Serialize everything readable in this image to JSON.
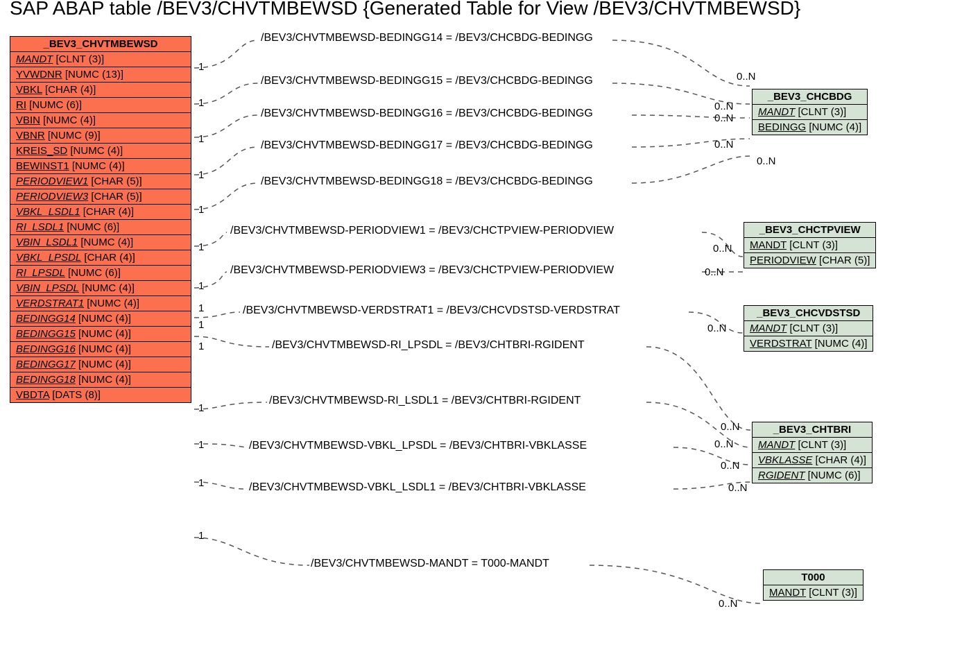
{
  "title": "SAP ABAP table /BEV3/CHVTMBEWSD {Generated Table for View /BEV3/CHVTMBEWSD}",
  "main": {
    "name": "_BEV3_CHVTMBEWSD",
    "rows": [
      {
        "f": "MANDT",
        "t": " [CLNT (3)]",
        "u": 1,
        "i": 1
      },
      {
        "f": "YVWDNR",
        "t": " [NUMC (13)]",
        "u": 1,
        "i": 0
      },
      {
        "f": "VBKL",
        "t": " [CHAR (4)]",
        "u": 1,
        "i": 0
      },
      {
        "f": "RI",
        "t": " [NUMC (6)]",
        "u": 1,
        "i": 0
      },
      {
        "f": "VBIN",
        "t": " [NUMC (4)]",
        "u": 1,
        "i": 0
      },
      {
        "f": "VBNR",
        "t": " [NUMC (9)]",
        "u": 1,
        "i": 0
      },
      {
        "f": "KREIS_SD",
        "t": " [NUMC (4)]",
        "u": 1,
        "i": 0
      },
      {
        "f": "BEWINST1",
        "t": " [NUMC (4)]",
        "u": 1,
        "i": 0
      },
      {
        "f": "PERIODVIEW1",
        "t": " [CHAR (5)]",
        "u": 1,
        "i": 1
      },
      {
        "f": "PERIODVIEW3",
        "t": " [CHAR (5)]",
        "u": 1,
        "i": 1
      },
      {
        "f": "VBKL_LSDL1",
        "t": " [CHAR (4)]",
        "u": 1,
        "i": 1
      },
      {
        "f": "RI_LSDL1",
        "t": " [NUMC (6)]",
        "u": 1,
        "i": 1
      },
      {
        "f": "VBIN_LSDL1",
        "t": " [NUMC (4)]",
        "u": 1,
        "i": 1
      },
      {
        "f": "VBKL_LPSDL",
        "t": " [CHAR (4)]",
        "u": 1,
        "i": 1
      },
      {
        "f": "RI_LPSDL",
        "t": " [NUMC (6)]",
        "u": 1,
        "i": 1
      },
      {
        "f": "VBIN_LPSDL",
        "t": " [NUMC (4)]",
        "u": 1,
        "i": 1
      },
      {
        "f": "VERDSTRAT1",
        "t": " [NUMC (4)]",
        "u": 1,
        "i": 1
      },
      {
        "f": "BEDINGG14",
        "t": " [NUMC (4)]",
        "u": 1,
        "i": 1
      },
      {
        "f": "BEDINGG15",
        "t": " [NUMC (4)]",
        "u": 1,
        "i": 1
      },
      {
        "f": "BEDINGG16",
        "t": " [NUMC (4)]",
        "u": 1,
        "i": 1
      },
      {
        "f": "BEDINGG17",
        "t": " [NUMC (4)]",
        "u": 1,
        "i": 1
      },
      {
        "f": "BEDINGG18",
        "t": " [NUMC (4)]",
        "u": 1,
        "i": 1
      },
      {
        "f": "VBDTA",
        "t": " [DATS (8)]",
        "u": 1,
        "i": 0
      }
    ]
  },
  "t_chcbdg": {
    "name": "_BEV3_CHCBDG",
    "rows": [
      {
        "f": "MANDT",
        "t": " [CLNT (3)]",
        "u": 1,
        "i": 1
      },
      {
        "f": "BEDINGG",
        "t": " [NUMC (4)]",
        "u": 1,
        "i": 0
      }
    ]
  },
  "t_chctpview": {
    "name": "_BEV3_CHCTPVIEW",
    "rows": [
      {
        "f": "MANDT",
        "t": " [CLNT (3)]",
        "u": 1,
        "i": 0
      },
      {
        "f": "PERIODVIEW",
        "t": " [CHAR (5)]",
        "u": 1,
        "i": 0
      }
    ]
  },
  "t_chcvdstsd": {
    "name": "_BEV3_CHCVDSTSD",
    "rows": [
      {
        "f": "MANDT",
        "t": " [CLNT (3)]",
        "u": 1,
        "i": 1
      },
      {
        "f": "VERDSTRAT",
        "t": " [NUMC (4)]",
        "u": 1,
        "i": 0
      }
    ]
  },
  "t_chtbri": {
    "name": "_BEV3_CHTBRI",
    "rows": [
      {
        "f": "MANDT",
        "t": " [CLNT (3)]",
        "u": 1,
        "i": 1
      },
      {
        "f": "VBKLASSE",
        "t": " [CHAR (4)]",
        "u": 1,
        "i": 1
      },
      {
        "f": "RGIDENT",
        "t": " [NUMC (6)]",
        "u": 1,
        "i": 1
      }
    ]
  },
  "t_t000": {
    "name": "T000",
    "rows": [
      {
        "f": "MANDT",
        "t": " [CLNT (3)]",
        "u": 1,
        "i": 0
      }
    ]
  },
  "rel": {
    "r0": "/BEV3/CHVTMBEWSD-BEDINGG14 = /BEV3/CHCBDG-BEDINGG",
    "r1": "/BEV3/CHVTMBEWSD-BEDINGG15 = /BEV3/CHCBDG-BEDINGG",
    "r2": "/BEV3/CHVTMBEWSD-BEDINGG16 = /BEV3/CHCBDG-BEDINGG",
    "r3": "/BEV3/CHVTMBEWSD-BEDINGG17 = /BEV3/CHCBDG-BEDINGG",
    "r4": "/BEV3/CHVTMBEWSD-BEDINGG18 = /BEV3/CHCBDG-BEDINGG",
    "r5": "/BEV3/CHVTMBEWSD-PERIODVIEW1 = /BEV3/CHCTPVIEW-PERIODVIEW",
    "r6": "/BEV3/CHVTMBEWSD-PERIODVIEW3 = /BEV3/CHCTPVIEW-PERIODVIEW",
    "r7": "/BEV3/CHVTMBEWSD-VERDSTRAT1 = /BEV3/CHCVDSTSD-VERDSTRAT",
    "r8": "/BEV3/CHVTMBEWSD-RI_LPSDL = /BEV3/CHTBRI-RGIDENT",
    "r9": "/BEV3/CHVTMBEWSD-RI_LSDL1 = /BEV3/CHTBRI-RGIDENT",
    "r10": "/BEV3/CHVTMBEWSD-VBKL_LPSDL = /BEV3/CHTBRI-VBKLASSE",
    "r11": "/BEV3/CHVTMBEWSD-VBKL_LSDL1 = /BEV3/CHTBRI-VBKLASSE",
    "r12": "/BEV3/CHVTMBEWSD-MANDT = T000-MANDT"
  },
  "card": {
    "one": "1",
    "many": "0..N"
  }
}
